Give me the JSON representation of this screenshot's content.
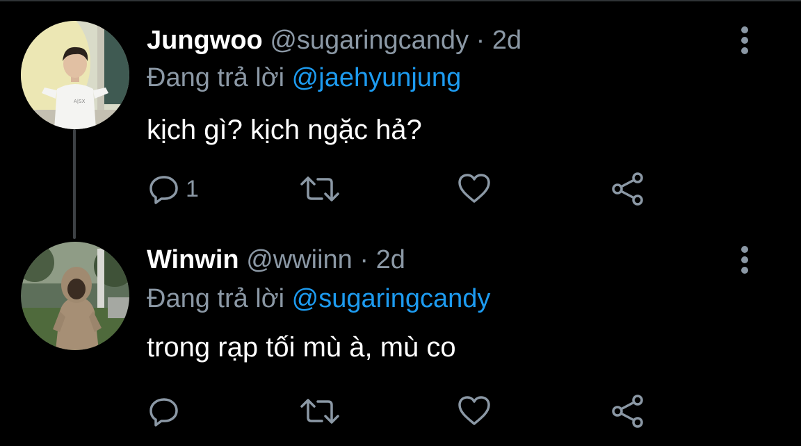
{
  "colors": {
    "background": "#000000",
    "name": "#ffffff",
    "secondary": "#8b98a5",
    "link": "#1d9bf0",
    "thread_line": "#3d4145"
  },
  "tweets": [
    {
      "display_name": "Jungwoo",
      "handle": "@sugaringcandy",
      "separator": "·",
      "time": "2d",
      "reply_prefix": "Đang trả lời",
      "reply_to": "@jaehyunjung",
      "text": "kịch gì? kịch ngặc hả?",
      "reply_count": "1",
      "icons": {
        "reply": "reply-icon",
        "retweet": "retweet-icon",
        "like": "like-icon",
        "share": "share-icon",
        "more": "more-vertical-icon"
      }
    },
    {
      "display_name": "Winwin",
      "handle": "@wwiinn",
      "separator": "·",
      "time": "2d",
      "reply_prefix": "Đang trả lời",
      "reply_to": "@sugaringcandy",
      "text": "trong rạp tối mù à, mù co",
      "reply_count": "",
      "icons": {
        "reply": "reply-icon",
        "retweet": "retweet-icon",
        "like": "like-icon",
        "share": "share-icon",
        "more": "more-vertical-icon"
      }
    }
  ]
}
